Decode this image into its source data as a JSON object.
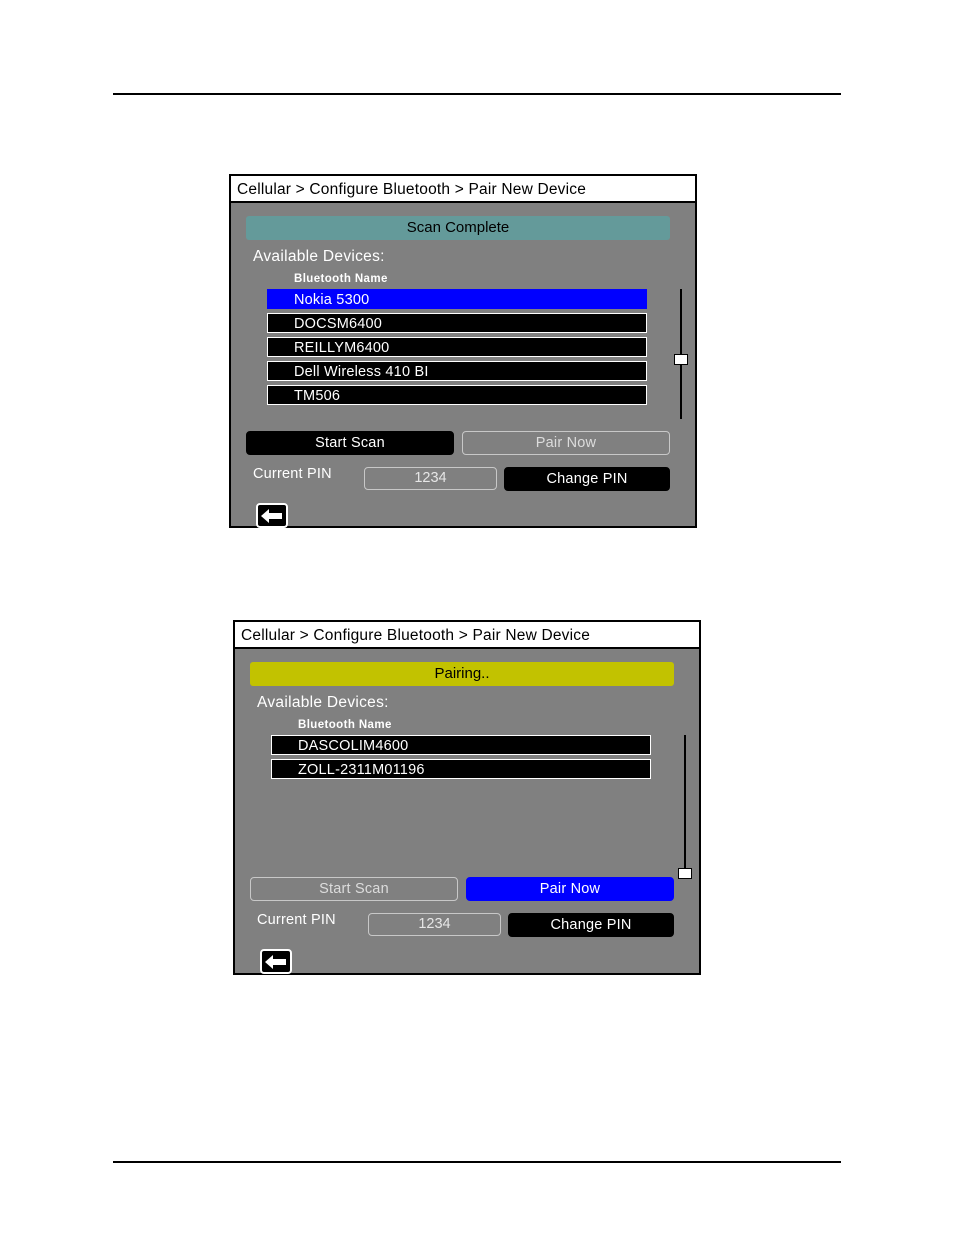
{
  "page": {
    "background": "#ffffff",
    "rule_color": "#000000"
  },
  "colors": {
    "panel_background": "#808080",
    "panel_border": "#000000",
    "titlebar_background": "#ffffff",
    "scan_complete_banner": "#649a9a",
    "pairing_banner": "#c2c200",
    "selected_row": "#0000ff",
    "row_background": "#000000",
    "row_text": "#ffffff",
    "active_button": "#0000ff"
  },
  "panels": [
    {
      "id": "scan-complete",
      "breadcrumb": "Cellular > Configure Bluetooth > Pair New Device",
      "status": {
        "label": "Scan Complete",
        "background": "#649a9a",
        "text_color": "#000000"
      },
      "available_devices_label": "Available Devices:",
      "column_header": "Bluetooth Name",
      "devices": [
        {
          "name": "Nokia 5300",
          "selected": true
        },
        {
          "name": "DOCSM6400",
          "selected": false
        },
        {
          "name": "REILLYM6400",
          "selected": false
        },
        {
          "name": "Dell Wireless 410 BI",
          "selected": false
        },
        {
          "name": "TM506",
          "selected": false
        }
      ],
      "scrollbar": {
        "thumb_position_percent": 50
      },
      "buttons": {
        "start_scan": {
          "label": "Start Scan",
          "state": "dark"
        },
        "pair_now": {
          "label": "Pair Now",
          "state": "ghost"
        },
        "change_pin": {
          "label": "Change PIN",
          "state": "dark"
        }
      },
      "pin": {
        "label": "Current PIN",
        "value": "1234"
      },
      "back_icon": "back-arrow-icon"
    },
    {
      "id": "pairing",
      "breadcrumb": "Cellular > Configure Bluetooth > Pair New Device",
      "status": {
        "label": "Pairing..",
        "background": "#c2c200",
        "text_color": "#000000"
      },
      "available_devices_label": "Available Devices:",
      "column_header": "Bluetooth Name",
      "devices": [
        {
          "name": "DASCOLIM4600",
          "selected": false
        },
        {
          "name": "ZOLL-2311M01196",
          "selected": false
        }
      ],
      "scrollbar": {
        "thumb_position_percent": 100
      },
      "buttons": {
        "start_scan": {
          "label": "Start Scan",
          "state": "ghost"
        },
        "pair_now": {
          "label": "Pair Now",
          "state": "active"
        },
        "change_pin": {
          "label": "Change PIN",
          "state": "dark"
        }
      },
      "pin": {
        "label": "Current PIN",
        "value": "1234"
      },
      "back_icon": "back-arrow-icon"
    }
  ]
}
